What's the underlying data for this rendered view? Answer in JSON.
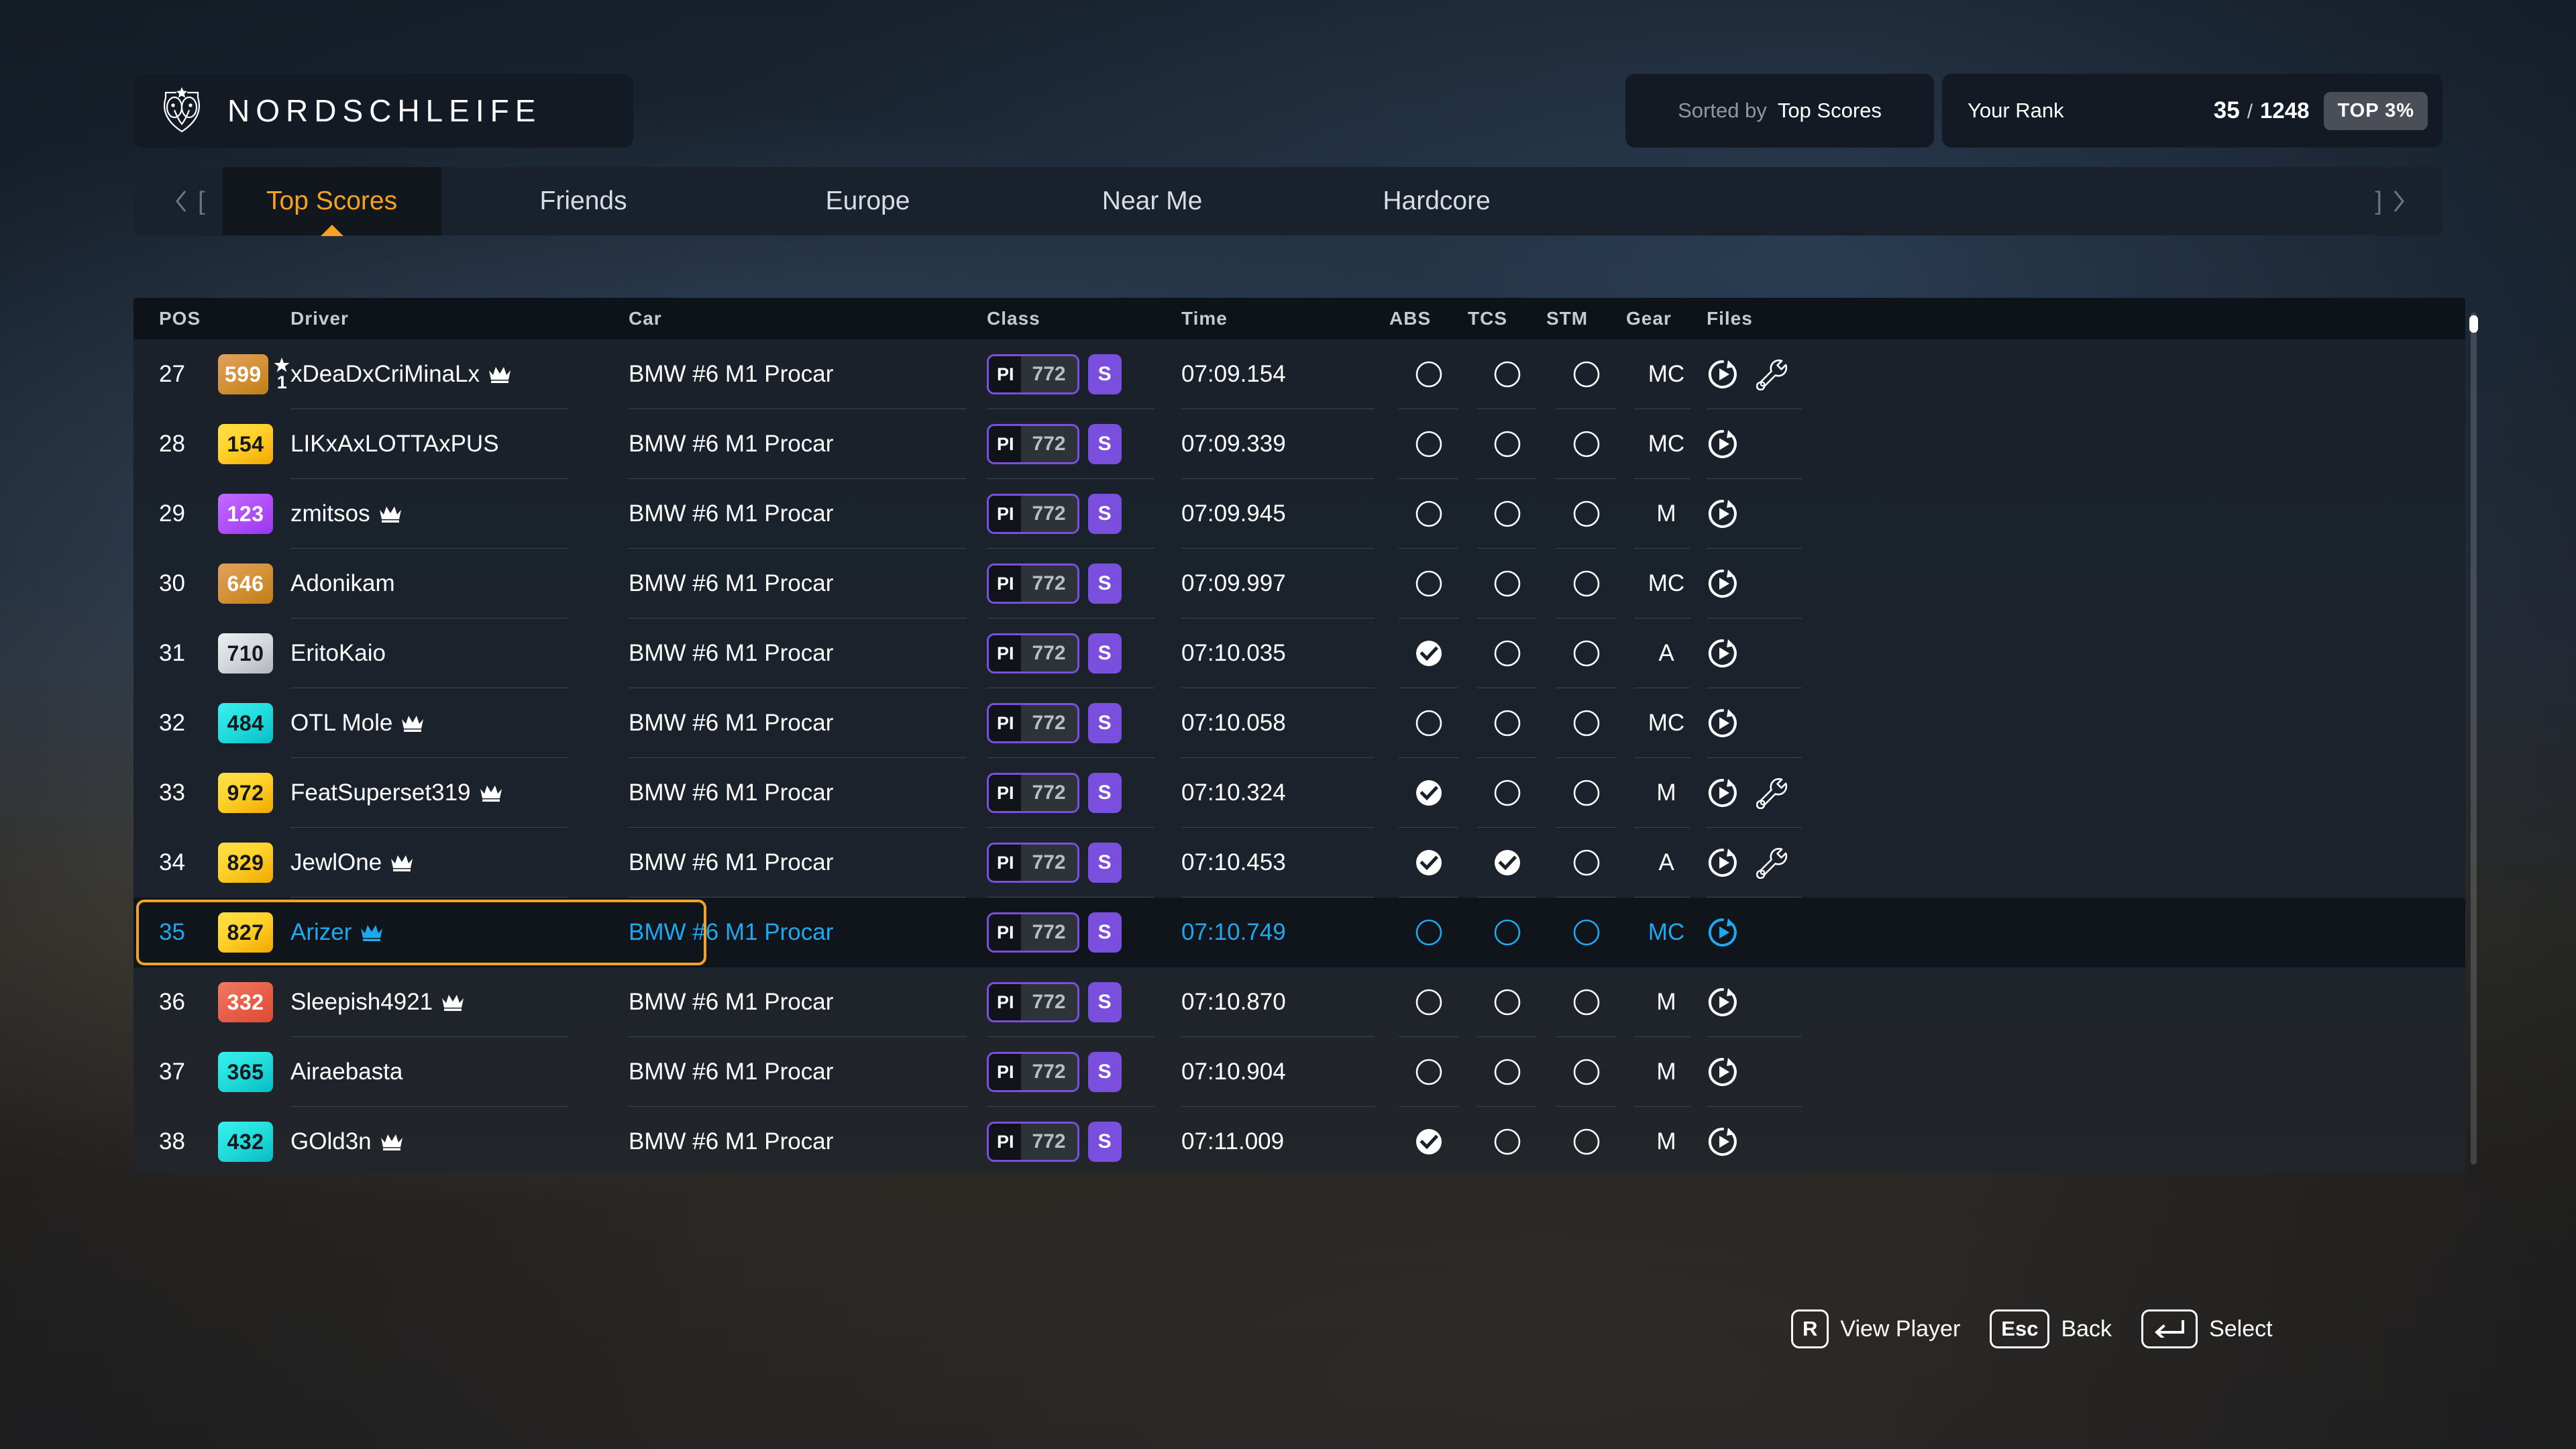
{
  "header": {
    "track_title": "NORDSCHLEIFE",
    "logo_icon": "crest-owl-icon",
    "sorted_by_label": "Sorted by",
    "sorted_by_value": "Top Scores",
    "your_rank_label": "Your Rank",
    "your_rank": "35",
    "rank_separator": "/",
    "rank_total": "1248",
    "top_percent": "TOP 3%"
  },
  "tabbar": {
    "prev_arrow_icon": "chevron-left-icon",
    "prev_bracket": "[",
    "next_bracket": "]",
    "next_arrow_icon": "chevron-right-icon",
    "tabs": [
      {
        "label": "Top Scores",
        "active": true
      },
      {
        "label": "Friends",
        "active": false
      },
      {
        "label": "Europe",
        "active": false
      },
      {
        "label": "Near Me",
        "active": false
      },
      {
        "label": "Hardcore",
        "active": false
      }
    ]
  },
  "table": {
    "columns": [
      "POS",
      "Driver",
      "Car",
      "Class",
      "Time",
      "ABS",
      "TCS",
      "STM",
      "Gear",
      "Files"
    ],
    "rows": [
      {
        "pos": "27",
        "badge": "599",
        "badge_color": "bronze",
        "trophy": true,
        "trophy_rank": "1",
        "driver": "xDeaDxCriMinaLx",
        "crown": true,
        "car": "BMW #6 M1 Procar",
        "class_key": "PI",
        "class_value": "772",
        "class_chip": "S",
        "time": "07:09.154",
        "abs": false,
        "tcs": false,
        "stm": false,
        "gear": "MC",
        "replay": true,
        "tune": true,
        "highlight": false
      },
      {
        "pos": "28",
        "badge": "154",
        "badge_color": "yellow",
        "trophy": false,
        "trophy_rank": "",
        "driver": "LIKxAxLOTTAxPUS",
        "crown": false,
        "car": "BMW #6 M1 Procar",
        "class_key": "PI",
        "class_value": "772",
        "class_chip": "S",
        "time": "07:09.339",
        "abs": false,
        "tcs": false,
        "stm": false,
        "gear": "MC",
        "replay": true,
        "tune": false,
        "highlight": false
      },
      {
        "pos": "29",
        "badge": "123",
        "badge_color": "purple",
        "trophy": false,
        "trophy_rank": "",
        "driver": "zmitsos",
        "crown": true,
        "car": "BMW #6 M1 Procar",
        "class_key": "PI",
        "class_value": "772",
        "class_chip": "S",
        "time": "07:09.945",
        "abs": false,
        "tcs": false,
        "stm": false,
        "gear": "M",
        "replay": true,
        "tune": false,
        "highlight": false
      },
      {
        "pos": "30",
        "badge": "646",
        "badge_color": "bronze",
        "trophy": false,
        "trophy_rank": "",
        "driver": "Adonikam",
        "crown": false,
        "car": "BMW #6 M1 Procar",
        "class_key": "PI",
        "class_value": "772",
        "class_chip": "S",
        "time": "07:09.997",
        "abs": false,
        "tcs": false,
        "stm": false,
        "gear": "MC",
        "replay": true,
        "tune": false,
        "highlight": false
      },
      {
        "pos": "31",
        "badge": "710",
        "badge_color": "silver",
        "trophy": false,
        "trophy_rank": "",
        "driver": "EritoKaio",
        "crown": false,
        "car": "BMW #6 M1 Procar",
        "class_key": "PI",
        "class_value": "772",
        "class_chip": "S",
        "time": "07:10.035",
        "abs": true,
        "tcs": false,
        "stm": false,
        "gear": "A",
        "replay": true,
        "tune": false,
        "highlight": false
      },
      {
        "pos": "32",
        "badge": "484",
        "badge_color": "cyan",
        "trophy": false,
        "trophy_rank": "",
        "driver": "OTL Mole",
        "crown": true,
        "car": "BMW #6 M1 Procar",
        "class_key": "PI",
        "class_value": "772",
        "class_chip": "S",
        "time": "07:10.058",
        "abs": false,
        "tcs": false,
        "stm": false,
        "gear": "MC",
        "replay": true,
        "tune": false,
        "highlight": false
      },
      {
        "pos": "33",
        "badge": "972",
        "badge_color": "yellow",
        "trophy": false,
        "trophy_rank": "",
        "driver": "FeatSuperset319",
        "crown": true,
        "car": "BMW #6 M1 Procar",
        "class_key": "PI",
        "class_value": "772",
        "class_chip": "S",
        "time": "07:10.324",
        "abs": true,
        "tcs": false,
        "stm": false,
        "gear": "M",
        "replay": true,
        "tune": true,
        "highlight": false
      },
      {
        "pos": "34",
        "badge": "829",
        "badge_color": "yellow",
        "trophy": false,
        "trophy_rank": "",
        "driver": "JewlOne",
        "crown": true,
        "car": "BMW #6 M1 Procar",
        "class_key": "PI",
        "class_value": "772",
        "class_chip": "S",
        "time": "07:10.453",
        "abs": true,
        "tcs": true,
        "stm": false,
        "gear": "A",
        "replay": true,
        "tune": true,
        "highlight": false
      },
      {
        "pos": "35",
        "badge": "827",
        "badge_color": "yellow",
        "trophy": false,
        "trophy_rank": "",
        "driver": "Arizer",
        "crown": true,
        "car": "BMW #6 M1 Procar",
        "class_key": "PI",
        "class_value": "772",
        "class_chip": "S",
        "time": "07:10.749",
        "abs": false,
        "tcs": false,
        "stm": false,
        "gear": "MC",
        "replay": true,
        "tune": false,
        "highlight": true
      },
      {
        "pos": "36",
        "badge": "332",
        "badge_color": "red",
        "trophy": false,
        "trophy_rank": "",
        "driver": "Sleepish4921",
        "crown": true,
        "car": "BMW #6 M1 Procar",
        "class_key": "PI",
        "class_value": "772",
        "class_chip": "S",
        "time": "07:10.870",
        "abs": false,
        "tcs": false,
        "stm": false,
        "gear": "M",
        "replay": true,
        "tune": false,
        "highlight": false
      },
      {
        "pos": "37",
        "badge": "365",
        "badge_color": "cyan",
        "trophy": false,
        "trophy_rank": "",
        "driver": "Airaebasta",
        "crown": false,
        "car": "BMW #6 M1 Procar",
        "class_key": "PI",
        "class_value": "772",
        "class_chip": "S",
        "time": "07:10.904",
        "abs": false,
        "tcs": false,
        "stm": false,
        "gear": "M",
        "replay": true,
        "tune": false,
        "highlight": false
      },
      {
        "pos": "38",
        "badge": "432",
        "badge_color": "cyan",
        "trophy": false,
        "trophy_rank": "",
        "driver": "GOld3n",
        "crown": true,
        "car": "BMW #6 M1 Procar",
        "class_key": "PI",
        "class_value": "772",
        "class_chip": "S",
        "time": "07:11.009",
        "abs": true,
        "tcs": false,
        "stm": false,
        "gear": "M",
        "replay": true,
        "tune": false,
        "highlight": false
      }
    ]
  },
  "footer": {
    "hints": [
      {
        "key": "R",
        "label": "View Player",
        "icon": ""
      },
      {
        "key": "Esc",
        "label": "Back",
        "icon": ""
      },
      {
        "key": "",
        "label": "Select",
        "icon": "enter-arrow-icon"
      }
    ]
  },
  "colors": {
    "accent_orange": "#f5a220",
    "selected_cyan": "#1fa8f0",
    "class_purple": "#7b4fdd",
    "panel_bg": "#1a212b",
    "header_bg": "#141a23"
  }
}
